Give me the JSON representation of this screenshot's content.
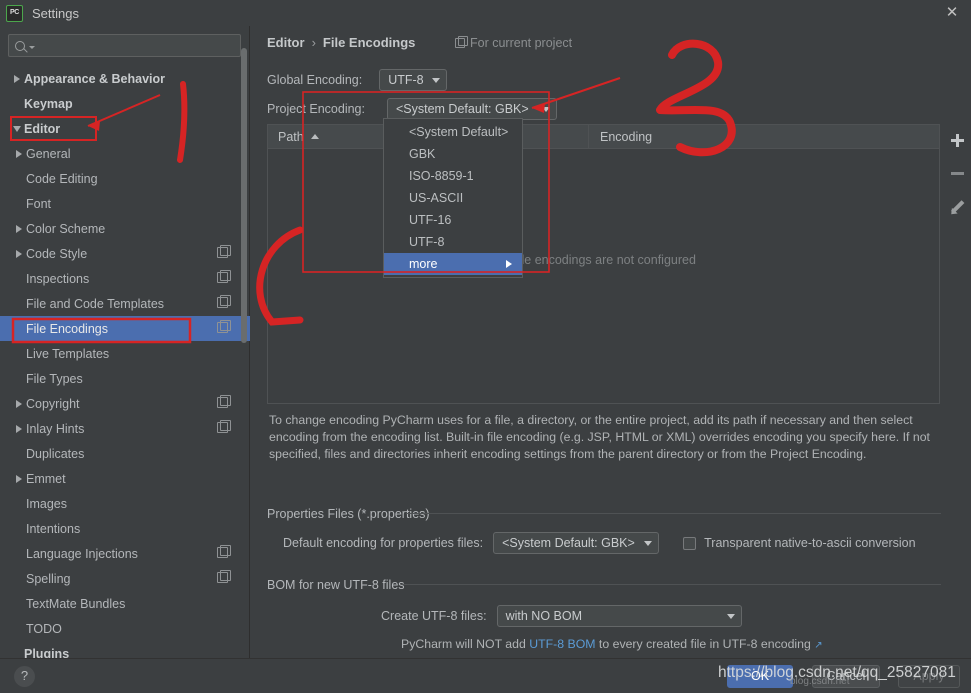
{
  "window": {
    "title": "Settings",
    "logo_text": "PC",
    "close_icon": "close-icon"
  },
  "sidebar": {
    "search_placeholder": "",
    "items": [
      {
        "label": "Appearance & Behavior",
        "twisty": "right",
        "level": 0,
        "bold": true,
        "selected": false,
        "copy_icon": false
      },
      {
        "label": "Keymap",
        "twisty": "none",
        "level": 0,
        "bold": true,
        "selected": false,
        "copy_icon": false
      },
      {
        "label": "Editor",
        "twisty": "down",
        "level": 0,
        "bold": true,
        "selected": false,
        "copy_icon": false
      },
      {
        "label": "General",
        "twisty": "right",
        "level": 1,
        "bold": false,
        "selected": false,
        "copy_icon": false
      },
      {
        "label": "Code Editing",
        "twisty": "none",
        "level": 1,
        "bold": false,
        "selected": false,
        "copy_icon": false
      },
      {
        "label": "Font",
        "twisty": "none",
        "level": 1,
        "bold": false,
        "selected": false,
        "copy_icon": false
      },
      {
        "label": "Color Scheme",
        "twisty": "right",
        "level": 1,
        "bold": false,
        "selected": false,
        "copy_icon": false
      },
      {
        "label": "Code Style",
        "twisty": "right",
        "level": 1,
        "bold": false,
        "selected": false,
        "copy_icon": true
      },
      {
        "label": "Inspections",
        "twisty": "none",
        "level": 1,
        "bold": false,
        "selected": false,
        "copy_icon": true
      },
      {
        "label": "File and Code Templates",
        "twisty": "none",
        "level": 1,
        "bold": false,
        "selected": false,
        "copy_icon": true
      },
      {
        "label": "File Encodings",
        "twisty": "none",
        "level": 1,
        "bold": false,
        "selected": true,
        "copy_icon": true
      },
      {
        "label": "Live Templates",
        "twisty": "none",
        "level": 1,
        "bold": false,
        "selected": false,
        "copy_icon": false
      },
      {
        "label": "File Types",
        "twisty": "none",
        "level": 1,
        "bold": false,
        "selected": false,
        "copy_icon": false
      },
      {
        "label": "Copyright",
        "twisty": "right",
        "level": 1,
        "bold": false,
        "selected": false,
        "copy_icon": true
      },
      {
        "label": "Inlay Hints",
        "twisty": "right",
        "level": 1,
        "bold": false,
        "selected": false,
        "copy_icon": true
      },
      {
        "label": "Duplicates",
        "twisty": "none",
        "level": 1,
        "bold": false,
        "selected": false,
        "copy_icon": false
      },
      {
        "label": "Emmet",
        "twisty": "right",
        "level": 1,
        "bold": false,
        "selected": false,
        "copy_icon": false
      },
      {
        "label": "Images",
        "twisty": "none",
        "level": 1,
        "bold": false,
        "selected": false,
        "copy_icon": false
      },
      {
        "label": "Intentions",
        "twisty": "none",
        "level": 1,
        "bold": false,
        "selected": false,
        "copy_icon": false
      },
      {
        "label": "Language Injections",
        "twisty": "none",
        "level": 1,
        "bold": false,
        "selected": false,
        "copy_icon": true
      },
      {
        "label": "Spelling",
        "twisty": "none",
        "level": 1,
        "bold": false,
        "selected": false,
        "copy_icon": true
      },
      {
        "label": "TextMate Bundles",
        "twisty": "none",
        "level": 1,
        "bold": false,
        "selected": false,
        "copy_icon": false
      },
      {
        "label": "TODO",
        "twisty": "none",
        "level": 1,
        "bold": false,
        "selected": false,
        "copy_icon": false
      },
      {
        "label": "Plugins",
        "twisty": "none",
        "level": 0,
        "bold": true,
        "selected": false,
        "copy_icon": false
      }
    ]
  },
  "main": {
    "breadcrumb": {
      "parent": "Editor",
      "separator": "›",
      "current": "File Encodings"
    },
    "for_current_project": "For current project",
    "global_encoding": {
      "label": "Global Encoding:",
      "value": "UTF-8"
    },
    "project_encoding": {
      "label": "Project Encoding:",
      "value": "<System Default: GBK>"
    },
    "table": {
      "col_path": "Path",
      "col_encoding": "Encoding",
      "empty_message": "File encodings are not configured",
      "buttons": {
        "add": "+",
        "remove": "−",
        "edit": "edit"
      }
    },
    "description": "To change encoding PyCharm uses for a file, a directory, or the entire project, add its path if necessary and then select encoding from the encoding list. Built-in file encoding (e.g. JSP, HTML or XML) overrides encoding you specify here. If not specified, files and directories inherit encoding settings from the parent directory or from the Project Encoding.",
    "properties_group": {
      "title": "Properties Files (*.properties)",
      "default_encoding_label": "Default encoding for properties files:",
      "default_encoding_value": "<System Default: GBK>",
      "transparent_label": "Transparent native-to-ascii conversion",
      "transparent_checked": false
    },
    "bom_group": {
      "title": "BOM for new UTF-8 files",
      "create_label": "Create UTF-8 files:",
      "create_value": "with NO BOM",
      "note_prefix": "PyCharm will NOT add ",
      "note_link": "UTF-8 BOM",
      "note_suffix": " to every created file in UTF-8 encoding ",
      "note_external_icon": "↗"
    }
  },
  "dropdown": {
    "items": [
      {
        "label": "<System Default>",
        "highlighted": false,
        "submenu": false
      },
      {
        "label": "GBK",
        "highlighted": false,
        "submenu": false
      },
      {
        "label": "ISO-8859-1",
        "highlighted": false,
        "submenu": false
      },
      {
        "label": "US-ASCII",
        "highlighted": false,
        "submenu": false
      },
      {
        "label": "UTF-16",
        "highlighted": false,
        "submenu": false
      },
      {
        "label": "UTF-8",
        "highlighted": false,
        "submenu": false
      },
      {
        "label": "more",
        "highlighted": true,
        "submenu": true
      }
    ]
  },
  "footer": {
    "help": "?",
    "ok": "OK",
    "cancel": "Cancel",
    "apply": "Apply"
  },
  "watermark": {
    "url": "https://blog.csdn.net/qq_25827081",
    "small": "blog.csdn.net"
  },
  "annotations": {
    "marker_two": "2",
    "accent_red": "#d62424",
    "selection_blue": "#4b6eaf"
  }
}
